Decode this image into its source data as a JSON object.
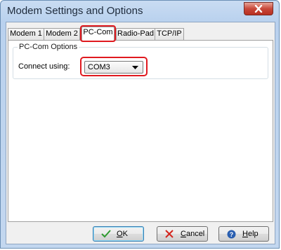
{
  "window": {
    "title": "Modem Settings and Options"
  },
  "tabs": [
    {
      "label": "Modem 1"
    },
    {
      "label": "Modem 2"
    },
    {
      "label": "PC-Com"
    },
    {
      "label": "Radio-Pad"
    },
    {
      "label": "TCP/IP"
    }
  ],
  "pccom": {
    "group_label": "PC-Com Options",
    "connect_label": "Connect using:",
    "connect_value": "COM3"
  },
  "buttons": {
    "ok": {
      "accel": "O",
      "rest": "K"
    },
    "cancel": {
      "accel": "C",
      "rest": "ancel"
    },
    "help": {
      "accel": "H",
      "rest": "elp"
    }
  },
  "colors": {
    "highlight": "#e0191f",
    "ok_check": "#2f9a2f",
    "cancel_x": "#d3241c",
    "help_icon": "#2a5fb0"
  }
}
